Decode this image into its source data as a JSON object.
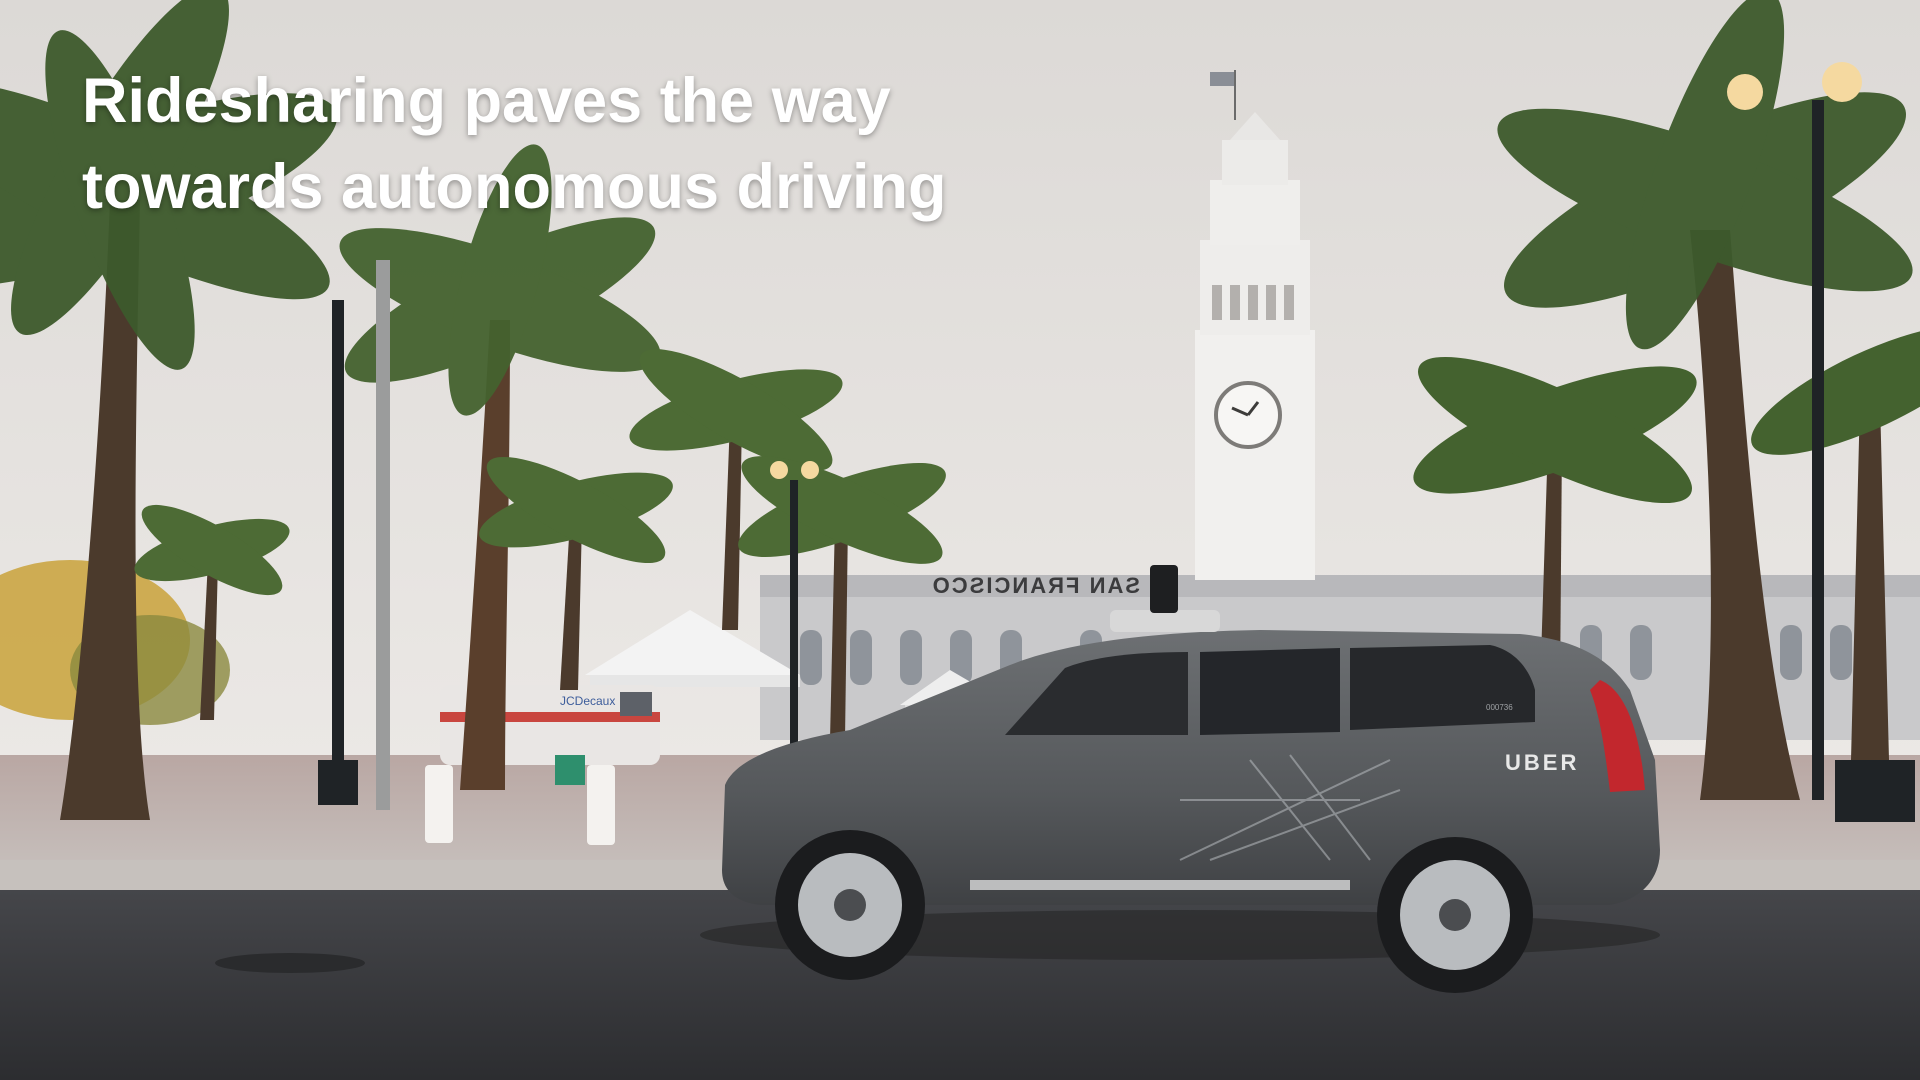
{
  "slide": {
    "title_line_1": "Ridesharing paves the way",
    "title_line_2": "towards autonomous driving"
  },
  "photo": {
    "building_sign": "SAN FRANCISCO",
    "vehicle_brand": "UBER",
    "van_logo": "JCDecaux",
    "vehicle_id": "000736"
  },
  "colors": {
    "title_text": "#ffffff",
    "sky": "#e4e1de",
    "car_body": "#5c5f62",
    "road": "#3a3b3d"
  }
}
